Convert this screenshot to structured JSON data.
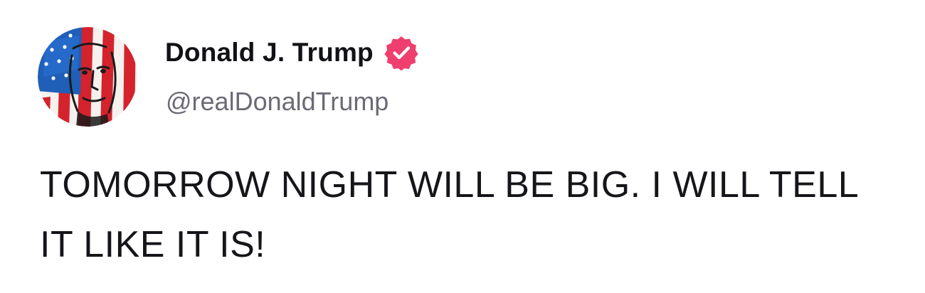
{
  "post": {
    "author": {
      "display_name": "Donald J. Trump",
      "handle": "@realDonaldTrump",
      "verified": true,
      "verified_badge_color": "#ee3f6e",
      "avatar_icon": "profile-photo-flag-portrait"
    },
    "text": "TOMORROW NIGHT WILL BE BIG. I WILL TELL IT LIKE IT IS!"
  }
}
